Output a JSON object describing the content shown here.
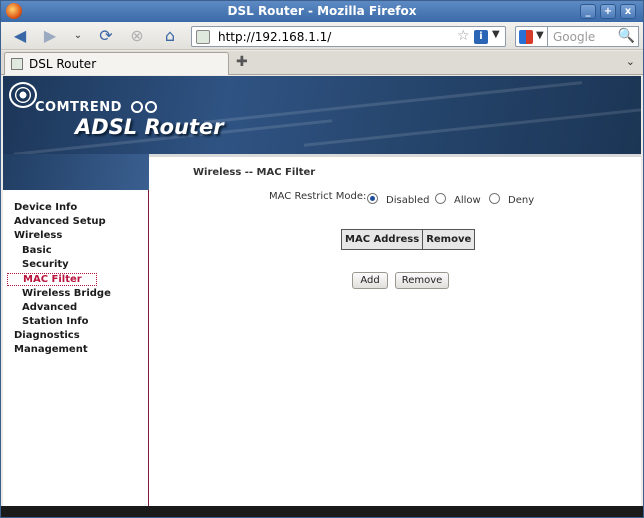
{
  "window": {
    "title": "DSL Router - Mozilla Firefox",
    "controls": {
      "minimize": "_",
      "maximize": "+",
      "close": "x"
    }
  },
  "navbar": {
    "url": "http://192.168.1.1/",
    "search_placeholder": "Google",
    "icons": [
      "back-icon",
      "forward-icon",
      "history-dropdown-icon",
      "reload-icon",
      "stop-icon",
      "home-icon"
    ]
  },
  "tabs": [
    {
      "label": "DSL Router",
      "active": true
    }
  ],
  "banner": {
    "brand": "COMTREND",
    "product": "ADSL Router"
  },
  "sidebar": {
    "items": [
      {
        "label": "Device Info",
        "level": 0,
        "active": false
      },
      {
        "label": "Advanced Setup",
        "level": 0,
        "active": false
      },
      {
        "label": "Wireless",
        "level": 0,
        "active": false
      },
      {
        "label": "Basic",
        "level": 1,
        "active": false
      },
      {
        "label": "Security",
        "level": 1,
        "active": false
      },
      {
        "label": "MAC Filter",
        "level": 1,
        "active": true
      },
      {
        "label": "Wireless Bridge",
        "level": 1,
        "active": false
      },
      {
        "label": "Advanced",
        "level": 1,
        "active": false
      },
      {
        "label": "Station Info",
        "level": 1,
        "active": false
      },
      {
        "label": "Diagnostics",
        "level": 0,
        "active": false
      },
      {
        "label": "Management",
        "level": 0,
        "active": false
      }
    ]
  },
  "main": {
    "heading": "Wireless -- MAC Filter",
    "restrict_label": "MAC Restrict Mode:",
    "modes": [
      {
        "label": "Disabled",
        "checked": true
      },
      {
        "label": "Allow",
        "checked": false
      },
      {
        "label": "Deny",
        "checked": false
      }
    ],
    "table_headers": [
      "MAC Address",
      "Remove"
    ],
    "buttons": {
      "add": "Add",
      "remove": "Remove"
    }
  },
  "colors": {
    "accent": "#b8143e",
    "banner": "#2f5383",
    "titlebar": "#4a78b5"
  }
}
